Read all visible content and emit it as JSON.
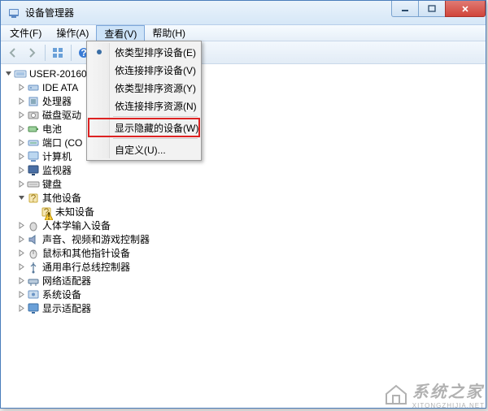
{
  "window": {
    "title": "设备管理器"
  },
  "menubar": {
    "items": [
      {
        "label": "文件(F)"
      },
      {
        "label": "操作(A)"
      },
      {
        "label": "查看(V)"
      },
      {
        "label": "帮助(H)"
      }
    ]
  },
  "view_menu": {
    "items": [
      {
        "label": "依类型排序设备(E)",
        "checked": true
      },
      {
        "label": "依连接排序设备(V)"
      },
      {
        "label": "依类型排序资源(Y)"
      },
      {
        "label": "依连接排序资源(N)"
      }
    ],
    "show_hidden": "显示隐藏的设备(W)",
    "customize": "自定义(U)..."
  },
  "tree": {
    "root": {
      "label": "USER-20160"
    },
    "nodes": [
      {
        "label": "IDE ATA",
        "icon": "ide"
      },
      {
        "label": "处理器",
        "icon": "cpu"
      },
      {
        "label": "磁盘驱动",
        "icon": "disk"
      },
      {
        "label": "电池",
        "icon": "battery"
      },
      {
        "label": "端口 (CO",
        "icon": "port"
      },
      {
        "label": "计算机",
        "icon": "computer"
      },
      {
        "label": "监视器",
        "icon": "monitor"
      },
      {
        "label": "键盘",
        "icon": "keyboard"
      },
      {
        "label": "其他设备",
        "icon": "other",
        "expanded": true,
        "children": [
          {
            "label": "未知设备",
            "icon": "unknown",
            "warn": true
          }
        ]
      },
      {
        "label": "人体学输入设备",
        "icon": "hid"
      },
      {
        "label": "声音、视频和游戏控制器",
        "icon": "sound"
      },
      {
        "label": "鼠标和其他指针设备",
        "icon": "mouse"
      },
      {
        "label": "通用串行总线控制器",
        "icon": "usb"
      },
      {
        "label": "网络适配器",
        "icon": "network"
      },
      {
        "label": "系统设备",
        "icon": "system"
      },
      {
        "label": "显示适配器",
        "icon": "display"
      }
    ]
  },
  "watermark": {
    "cn": "系统之家",
    "en": "XITONGZHIJIA.NET"
  }
}
